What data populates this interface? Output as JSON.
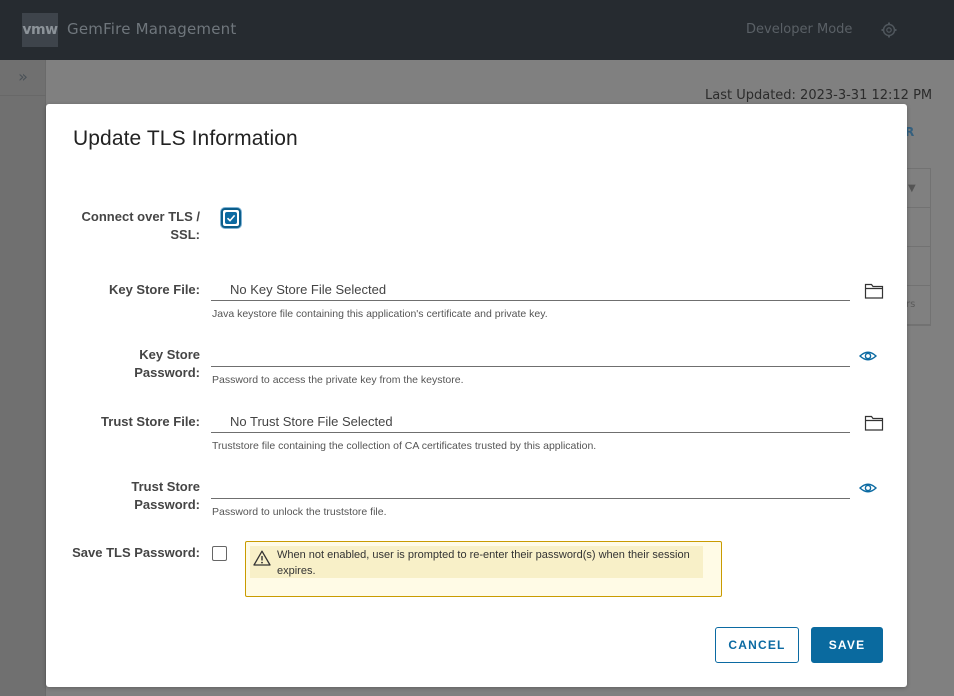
{
  "header": {
    "logo": "vmw",
    "app_title": "GemFire Management",
    "developer_mode_label": "Developer Mode",
    "settings_icon": "gear-icon"
  },
  "background": {
    "sidebar_toggle_icon": "double-chevron-right-icon",
    "sidebar_toggle_glyph": "»",
    "last_updated": "Last Updated: 2023-3-31 12:12 PM",
    "link_fragment": "R",
    "sort_glyph": "▼",
    "cell_fragment": "rs"
  },
  "modal": {
    "title": "Update TLS Information",
    "fields": {
      "connect_tls": {
        "label": "Connect over TLS / SSL:",
        "checked": true
      },
      "key_store_file": {
        "label": "Key Store File:",
        "value": "No Key Store File Selected",
        "help": "Java keystore file containing this application's certificate and private key.",
        "icon": "folder-icon"
      },
      "key_store_password": {
        "label": "Key Store Password:",
        "value": "",
        "help": "Password to access the private key from the keystore.",
        "icon": "eye-icon"
      },
      "trust_store_file": {
        "label": "Trust Store File:",
        "value": "No Trust Store File Selected",
        "help": "Truststore file containing the collection of CA certificates trusted by this application.",
        "icon": "folder-icon"
      },
      "trust_store_password": {
        "label": "Trust Store Password:",
        "value": "",
        "help": "Password to unlock the truststore file.",
        "icon": "eye-icon"
      },
      "save_tls_password": {
        "label": "Save TLS Password:",
        "checked": false,
        "warning": "When not enabled, user is prompted to re-enter their password(s) when their session expires.",
        "warning_icon": "warning-triangle-icon"
      }
    },
    "buttons": {
      "cancel": "CANCEL",
      "save": "SAVE"
    }
  },
  "colors": {
    "primary": "#0a6a9f",
    "header_bg": "#262b30",
    "warning_border": "#c99b00",
    "warning_bg": "#fffbe6"
  }
}
